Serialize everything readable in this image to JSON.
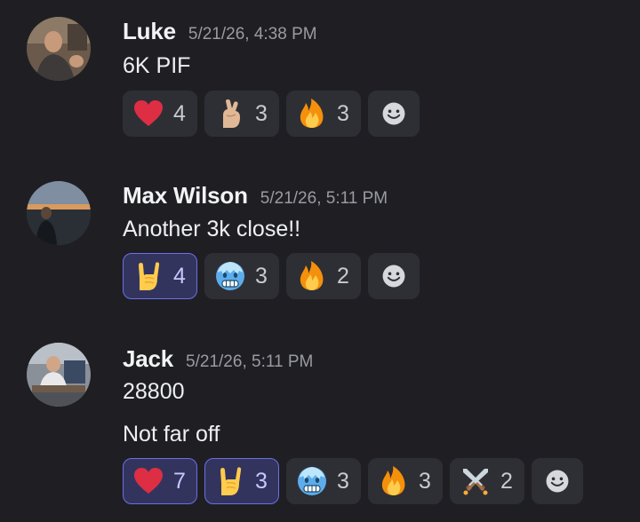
{
  "messages": [
    {
      "author": "Luke",
      "timestamp": "5/21/26, 4:38 PM",
      "lines": [
        "6K PIF"
      ],
      "reactions": [
        {
          "emoji": "red-heart-icon",
          "count": "4",
          "me": false
        },
        {
          "emoji": "crossed-fingers-icon",
          "count": "3",
          "me": false
        },
        {
          "emoji": "fire-icon",
          "count": "3",
          "me": false
        }
      ]
    },
    {
      "author": "Max Wilson",
      "timestamp": "5/21/26, 5:11 PM",
      "lines": [
        "Another 3k close!!"
      ],
      "reactions": [
        {
          "emoji": "sign-of-horns-icon",
          "count": "4",
          "me": true
        },
        {
          "emoji": "cold-face-icon",
          "count": "3",
          "me": false
        },
        {
          "emoji": "fire-icon",
          "count": "2",
          "me": false
        }
      ]
    },
    {
      "author": "Jack",
      "timestamp": "5/21/26, 5:11 PM",
      "lines": [
        "28800",
        "Not far off"
      ],
      "reactions": [
        {
          "emoji": "red-heart-icon",
          "count": "7",
          "me": true
        },
        {
          "emoji": "sign-of-horns-icon",
          "count": "3",
          "me": true
        },
        {
          "emoji": "cold-face-icon",
          "count": "3",
          "me": false
        },
        {
          "emoji": "fire-icon",
          "count": "3",
          "me": false
        },
        {
          "emoji": "crossed-swords-icon",
          "count": "2",
          "me": false
        }
      ]
    }
  ],
  "add_reaction_icon": "smiley-add-reaction-icon",
  "colors": {
    "background": "#1f1f23",
    "reaction_bg": "#2e2f34",
    "reacted_bg": "#33345e",
    "reacted_border": "#6a6fe6",
    "timestamp": "#9a9ba1"
  }
}
